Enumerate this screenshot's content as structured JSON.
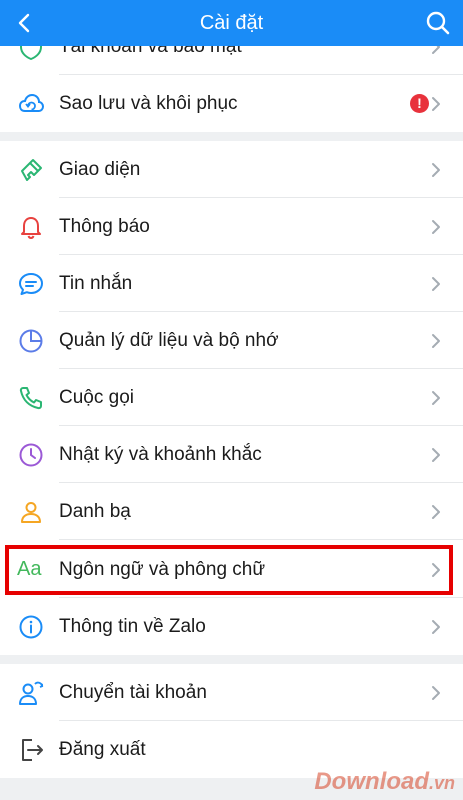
{
  "header": {
    "title": "Cài đặt"
  },
  "rows": [
    {
      "label": "Tài khoản và bảo mật"
    },
    {
      "label": "Sao lưu và khôi phục",
      "alert": "!"
    },
    {
      "label": "Giao diện"
    },
    {
      "label": "Thông báo"
    },
    {
      "label": "Tin nhắn"
    },
    {
      "label": "Quản lý dữ liệu và bộ nhớ"
    },
    {
      "label": "Cuộc gọi"
    },
    {
      "label": "Nhật ký và khoảnh khắc"
    },
    {
      "label": "Danh bạ"
    },
    {
      "label": "Ngôn ngữ và phông chữ",
      "icon_text": "Aa"
    },
    {
      "label": "Thông tin về Zalo"
    },
    {
      "label": "Chuyển tài khoản"
    },
    {
      "label": "Đăng xuất"
    }
  ],
  "watermark": {
    "text": "Download",
    "suffix": ".vn"
  },
  "colors": {
    "header": "#1a8cf7",
    "highlight": "#e60000",
    "alert": "#e8323c"
  }
}
